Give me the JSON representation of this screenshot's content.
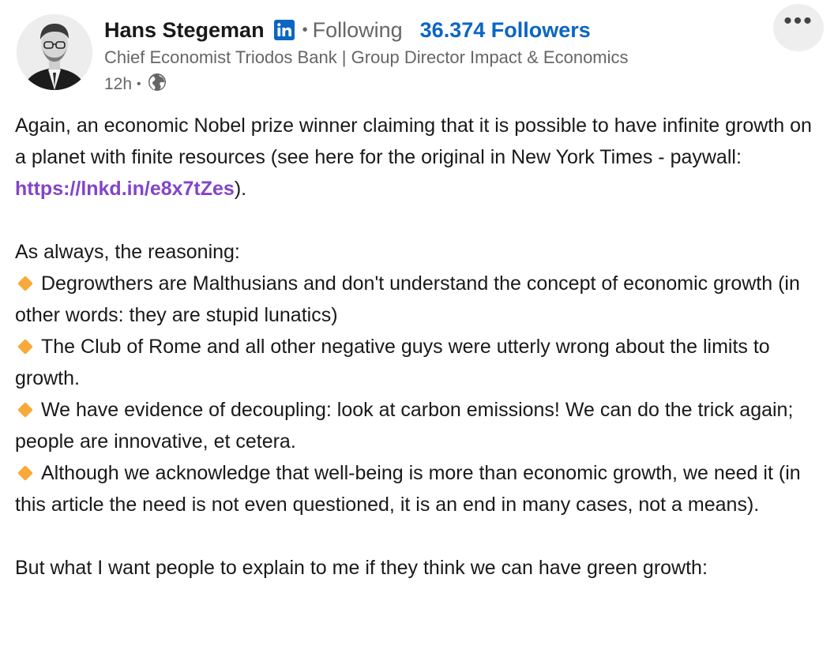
{
  "author": {
    "name": "Hans Stegeman",
    "connection": "Following",
    "followers": "36.374 Followers",
    "headline": "Chief Economist Triodos Bank | Group Director Impact & Economics",
    "time": "12h"
  },
  "icons": {
    "linkedin_badge": "linkedin-icon",
    "visibility": "globe-icon",
    "more": "more-icon",
    "bullet": "orange-diamond-icon"
  },
  "colors": {
    "link": "#8344cc",
    "followers": "#0a66c2",
    "linkedin": "#0a66c2",
    "bullet": "#f7a93a"
  },
  "post": {
    "intro_before_link": "Again, an economic Nobel prize winner claiming that it is possible to have infinite growth on a planet with finite resources (see here for the original in New York Times - paywall: ",
    "link": "https://lnkd.in/e8x7tZes",
    "intro_after_link": ").",
    "reasoning_heading": "As always, the reasoning:",
    "bullets": [
      "Degrowthers are Malthusians and don't understand the concept of economic growth (in other words: they are stupid lunatics)",
      "The Club of Rome and all other negative guys were utterly wrong about the limits to growth.",
      "We have evidence of decoupling: look at carbon emissions! We can do the trick again; people are innovative, et cetera.",
      "Although we acknowledge that well-being is more than economic growth, we need it (in this article the need is not even questioned, it is an end in many cases, not a means)."
    ],
    "closing": "But what I want people to explain to me if they think we can have green growth:"
  }
}
